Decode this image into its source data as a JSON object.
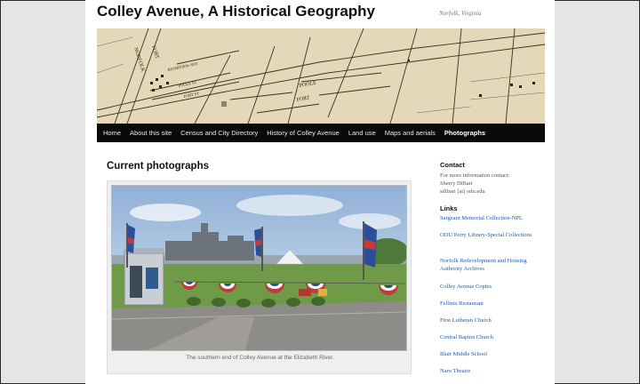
{
  "site": {
    "title": "Colley Avenue, A Historical Geography",
    "description": "Norfolk, Virginia"
  },
  "header_map": {
    "labels": [
      "FORT",
      "NORFOLK",
      "RIVERVIEW AVE",
      "POOLE ST",
      "FORT ST",
      "POOLE",
      "FORT"
    ]
  },
  "nav": {
    "items": [
      {
        "label": "Home",
        "active": false
      },
      {
        "label": "About this site",
        "active": false
      },
      {
        "label": "Census and City Directory",
        "active": false
      },
      {
        "label": "History of Colley Avenue",
        "active": false
      },
      {
        "label": "Land use",
        "active": false
      },
      {
        "label": "Maps and aerials",
        "active": false
      },
      {
        "label": "Photographs",
        "active": true
      }
    ]
  },
  "main": {
    "heading": "Current photographs",
    "photo_caption": "The southern end of Colley Avenue at the Elizabeth River."
  },
  "sidebar": {
    "contact_heading": "Contact",
    "contact_lines": [
      "For more information contact:",
      "Sherry DiBari",
      "sdibari [at] odu.edu"
    ],
    "links_heading": "Links",
    "links": [
      "Sargeant Memorial Collection-NPL",
      "ODU Perry Library-Special Collections",
      "Norfolk Redevelopment and Housing Authority Archives",
      "Colley Avenue Copies",
      "Fellinis Restaurant",
      "First Lutheran Church",
      "Central Baptist Church",
      "Blair Middle School",
      "Naro Theatre"
    ]
  },
  "colors": {
    "nav_bg": "#0a0a0a",
    "link": "#1b5bb8",
    "map_paper": "#e8dcc0"
  }
}
